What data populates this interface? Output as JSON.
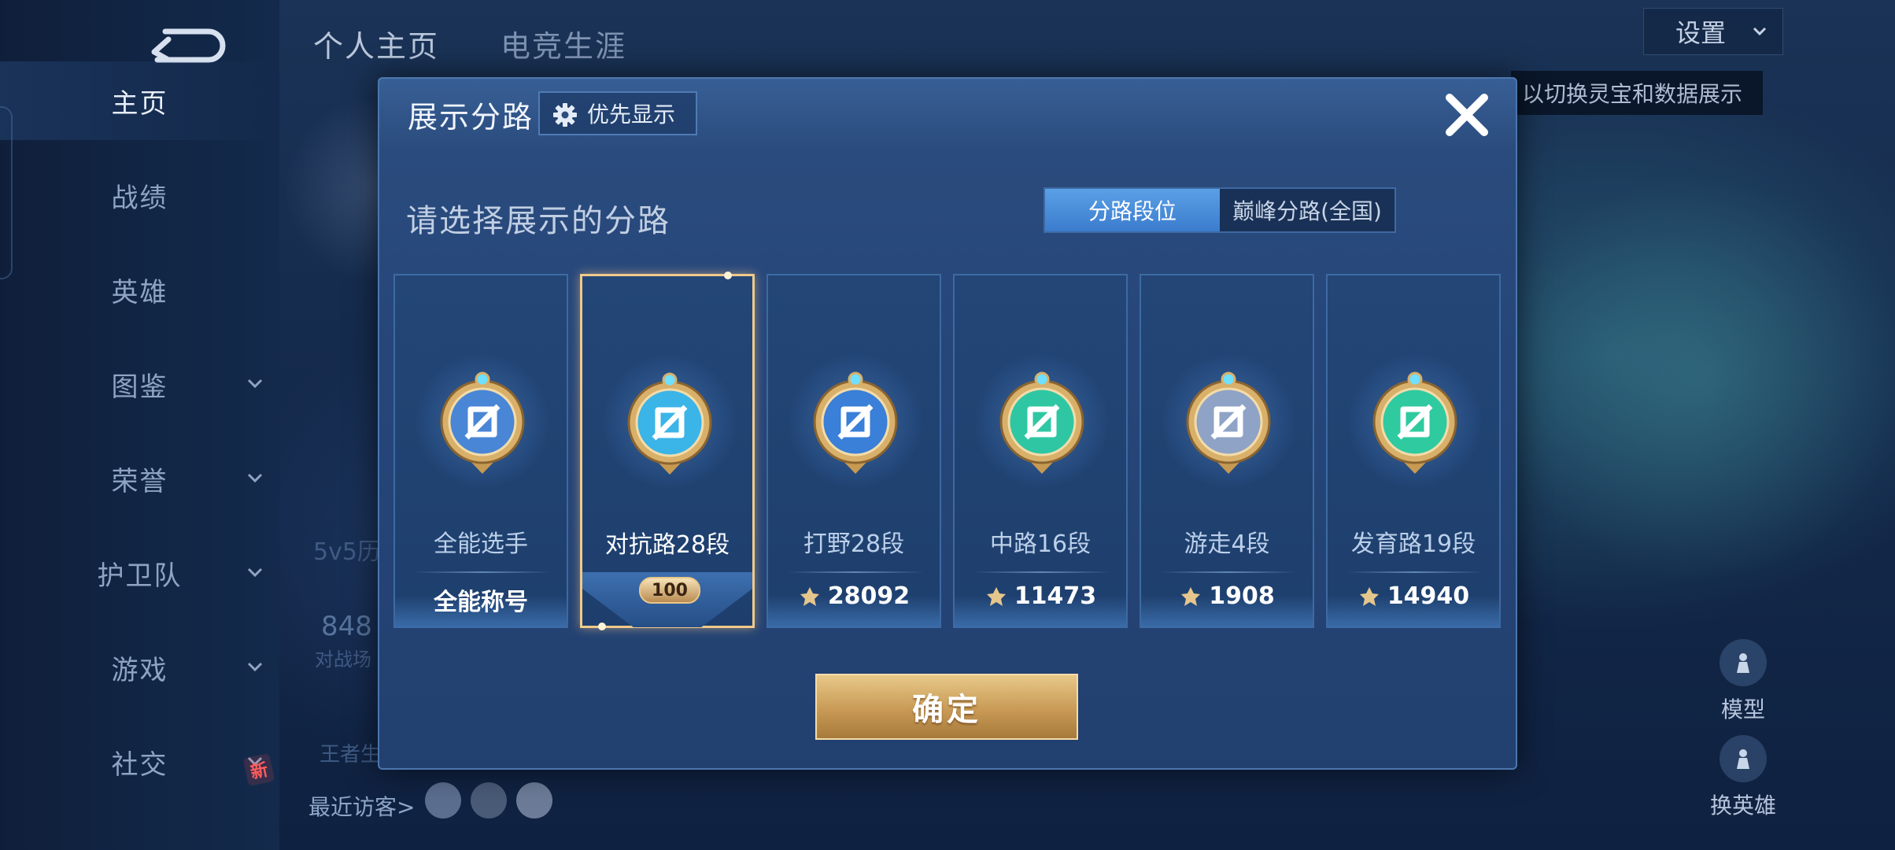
{
  "sidebar": {
    "items": [
      {
        "label": "主页",
        "active": true,
        "chevron": false
      },
      {
        "label": "战绩",
        "active": false,
        "chevron": false
      },
      {
        "label": "英雄",
        "active": false,
        "chevron": false
      },
      {
        "label": "图鉴",
        "active": false,
        "chevron": true
      },
      {
        "label": "荣誉",
        "active": false,
        "chevron": true
      },
      {
        "label": "护卫队",
        "active": false,
        "chevron": true
      },
      {
        "label": "游戏",
        "active": false,
        "chevron": true
      },
      {
        "label": "社交",
        "active": false,
        "chevron": true
      }
    ],
    "new_badge": "新"
  },
  "top_tabs": [
    "个人主页",
    "电竞生涯"
  ],
  "settings_label": "设置",
  "hint_text": "以切换灵宝和数据展示",
  "background": {
    "left_label": "5v5历",
    "left_number": "848",
    "left_sub": "对战场",
    "left_sub2": "王者生",
    "recent_visitors": "最近访客>",
    "model_label": "模型",
    "swap_hero_label": "换英雄"
  },
  "modal": {
    "title": "展示分路",
    "priority_button": "优先显示",
    "subtitle": "请选择展示的分路",
    "toggle": {
      "options": [
        "分路段位",
        "巅峰分路(全国)"
      ],
      "selected": "分路段位"
    },
    "cards": [
      {
        "rank": "全能选手",
        "score": "全能称号",
        "icon_name": "allround-emblem-icon",
        "show_score_icon": false,
        "selected": false,
        "accent": "#4a86d6"
      },
      {
        "rank": "对抗路28段",
        "score": "100",
        "icon_name": "clash-lane-emblem-icon",
        "show_score_icon": false,
        "selected": true,
        "accent": "#3bb4e8"
      },
      {
        "rank": "打野28段",
        "score": "28092",
        "icon_name": "jungle-emblem-icon",
        "show_score_icon": true,
        "selected": false,
        "accent": "#3a7fd8"
      },
      {
        "rank": "中路16段",
        "score": "11473",
        "icon_name": "mid-lane-emblem-icon",
        "show_score_icon": true,
        "selected": false,
        "accent": "#2fc7a3"
      },
      {
        "rank": "游走4段",
        "score": "1908",
        "icon_name": "roam-emblem-icon",
        "show_score_icon": true,
        "selected": false,
        "accent": "#8fa3c6"
      },
      {
        "rank": "发育路19段",
        "score": "14940",
        "icon_name": "farm-lane-emblem-icon",
        "show_score_icon": true,
        "selected": false,
        "accent": "#2fcaa0"
      }
    ],
    "confirm_button": "确定"
  },
  "colors": {
    "modal_bg": "#26467a",
    "gold": "#c89a55",
    "toggle_on": "#3b7ccd"
  }
}
